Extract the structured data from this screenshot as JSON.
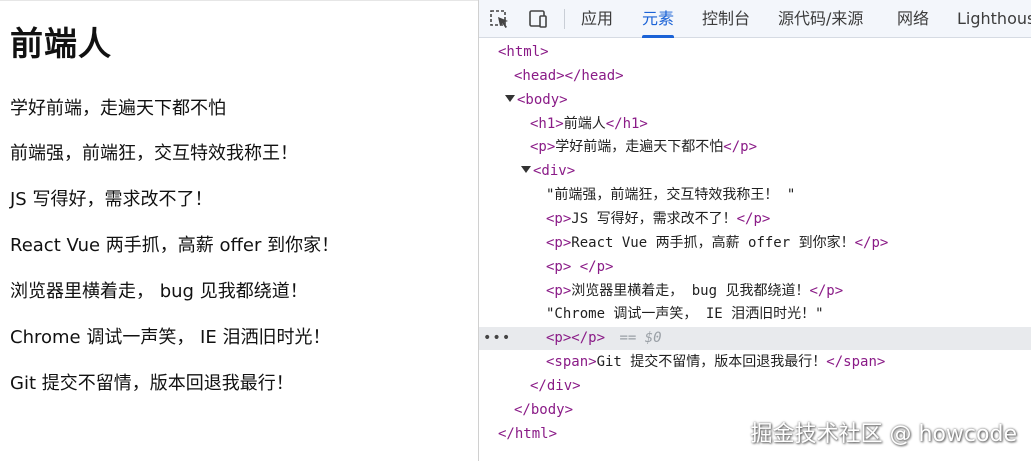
{
  "page": {
    "heading": "前端人",
    "paragraphs": [
      "学好前端，走遍天下都不怕",
      "前端强，前端狂，交互特效我称王！",
      "JS 写得好，需求改不了！",
      "React Vue 两手抓，高薪 offer 到你家！",
      "浏览器里横着走， bug 见我都绕道！",
      "Chrome 调试一声笑， IE 泪洒旧时光！",
      "Git 提交不留情，版本回退我最行！"
    ]
  },
  "devtools": {
    "inspect_icon": "inspect-element-icon",
    "device_icon": "device-toolbar-icon",
    "tabs": [
      "应用",
      "元素",
      "控制台",
      "源代码/来源",
      "网络",
      "Lighthouse"
    ],
    "active_tab": "元素",
    "accent_color": "#1a62d6",
    "tag_color": "#8a1b87",
    "tree": {
      "html_open": "<html>",
      "head": "<head></head>",
      "body_open": "<body>",
      "h1": {
        "open": "<h1>",
        "text": "前端人",
        "close": "</h1>"
      },
      "p1": {
        "open": "<p>",
        "text": "学好前端，走遍天下都不怕",
        "close": "</p>"
      },
      "div_open": "<div>",
      "div_text1": "\"前端强，前端狂，交互特效我称王！ \"",
      "p2": {
        "open": "<p>",
        "text": "JS 写得好，需求改不了！",
        "close": "</p>"
      },
      "p3": {
        "open": "<p>",
        "text": "React Vue 两手抓，高薪 offer 到你家！",
        "close": "</p>"
      },
      "p4": {
        "open": "<p>",
        "text": " ",
        "close": "</p>"
      },
      "p5": {
        "open": "<p>",
        "text": "浏览器里横着走， bug 见我都绕道！",
        "close": "</p>"
      },
      "div_text2": "\"Chrome 调试一声笑， IE 泪洒旧时光！\"",
      "p6": {
        "open": "<p>",
        "close": "</p>",
        "marker": "== $0"
      },
      "span": {
        "open": "<span>",
        "text": "Git 提交不留情，版本回退我最行！",
        "close": "</span>"
      },
      "div_close": "</div>",
      "body_close": "</body>",
      "html_close": "</html>",
      "ellipsis": "•••"
    }
  },
  "watermark": "掘金技术社区 @ howcode"
}
